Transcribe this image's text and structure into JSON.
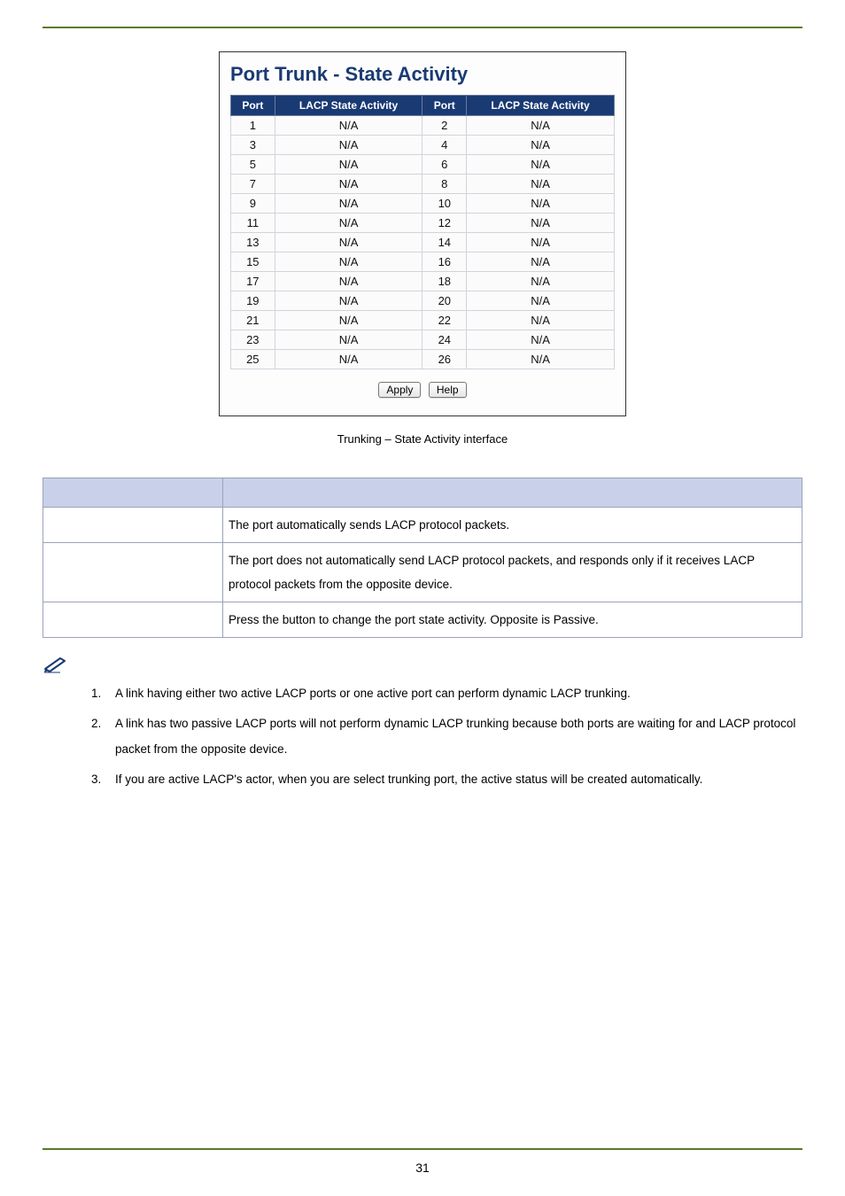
{
  "shot": {
    "title": "Port Trunk - State Activity",
    "headers": [
      "Port",
      "LACP State Activity",
      "Port",
      "LACP State Activity"
    ],
    "rows": [
      {
        "p1": "1",
        "s1": "N/A",
        "p2": "2",
        "s2": "N/A"
      },
      {
        "p1": "3",
        "s1": "N/A",
        "p2": "4",
        "s2": "N/A"
      },
      {
        "p1": "5",
        "s1": "N/A",
        "p2": "6",
        "s2": "N/A"
      },
      {
        "p1": "7",
        "s1": "N/A",
        "p2": "8",
        "s2": "N/A"
      },
      {
        "p1": "9",
        "s1": "N/A",
        "p2": "10",
        "s2": "N/A"
      },
      {
        "p1": "11",
        "s1": "N/A",
        "p2": "12",
        "s2": "N/A"
      },
      {
        "p1": "13",
        "s1": "N/A",
        "p2": "14",
        "s2": "N/A"
      },
      {
        "p1": "15",
        "s1": "N/A",
        "p2": "16",
        "s2": "N/A"
      },
      {
        "p1": "17",
        "s1": "N/A",
        "p2": "18",
        "s2": "N/A"
      },
      {
        "p1": "19",
        "s1": "N/A",
        "p2": "20",
        "s2": "N/A"
      },
      {
        "p1": "21",
        "s1": "N/A",
        "p2": "22",
        "s2": "N/A"
      },
      {
        "p1": "23",
        "s1": "N/A",
        "p2": "24",
        "s2": "N/A"
      },
      {
        "p1": "25",
        "s1": "N/A",
        "p2": "26",
        "s2": "N/A"
      }
    ],
    "buttons": {
      "apply": "Apply",
      "help": "Help"
    }
  },
  "caption": "Trunking – State Activity interface",
  "info": {
    "rows": [
      {
        "label": "",
        "desc": "The port automatically sends LACP protocol packets."
      },
      {
        "label": "",
        "desc": "The port does not automatically send LACP protocol packets, and responds only if it receives LACP protocol packets from the opposite device."
      },
      {
        "label": "",
        "desc": "Press the button to change the port state activity. Opposite is Passive."
      }
    ]
  },
  "notes": {
    "items": [
      "A link having either two active LACP ports or one active port can perform dynamic LACP trunking.",
      "A link has two passive LACP ports will not perform dynamic LACP trunking because both ports are waiting for and LACP protocol packet from the opposite device.",
      "If you are active LACP's actor, when you are select trunking port, the active status will be created automatically."
    ]
  },
  "page_number": "31"
}
